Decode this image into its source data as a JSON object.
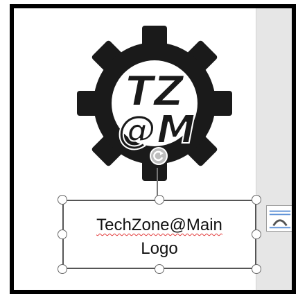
{
  "textbox": {
    "line1": "TechZone@Main",
    "line2": "Logo"
  },
  "logo": {
    "letters_top": "TZ",
    "letters_bottom": "@M",
    "color": "#1a1a1a"
  },
  "icons": {
    "rotate": "rotate-handle-icon",
    "layout_options": "layout-options-icon"
  },
  "colors": {
    "spellcheck": "#e23a3a",
    "handle_border": "#666666",
    "margin_bg": "#e6e6e6"
  }
}
